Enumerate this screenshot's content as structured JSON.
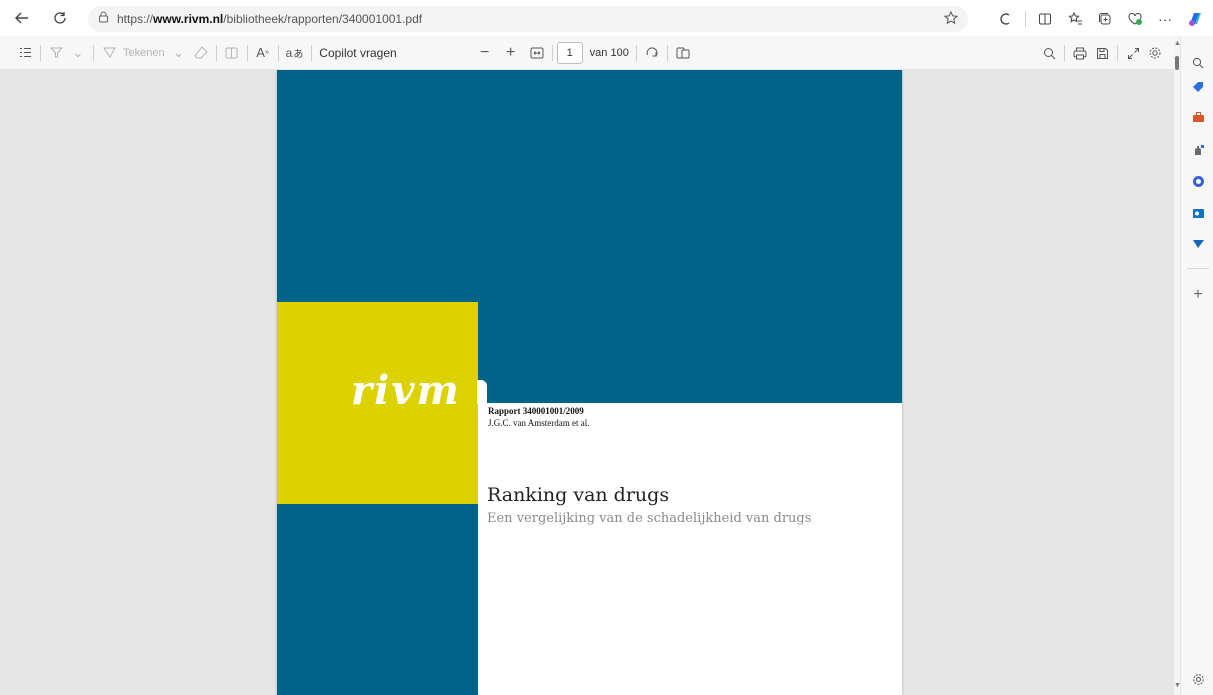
{
  "address_bar": {
    "url_prefix": "https://",
    "url_domain": "www.rivm.nl",
    "url_path": "/bibliotheek/rapporten/340001001.pdf"
  },
  "pdf_toolbar": {
    "draw_label": "Tekenen",
    "copilot_label": "Copilot vragen",
    "page_current": "1",
    "page_total_label": "van 100"
  },
  "document": {
    "logo_text": "rivm",
    "report_number": "Rapport 340001001/2009",
    "authors": "J.G.C. van Amsterdam et al.",
    "title": "Ranking van drugs",
    "subtitle": "Een vergelijking van de schadelijkheid van drugs"
  },
  "colors": {
    "cover_blue": "#006488",
    "cover_yellow": "#dbd200",
    "viewer_background": "#e6e6e6"
  },
  "icons": {
    "back": "back-arrow-icon",
    "refresh": "refresh-icon",
    "lock": "lock-icon",
    "favorite": "star-icon",
    "sidebar_add": "plus-icon",
    "sidebar_settings": "gear-icon"
  }
}
